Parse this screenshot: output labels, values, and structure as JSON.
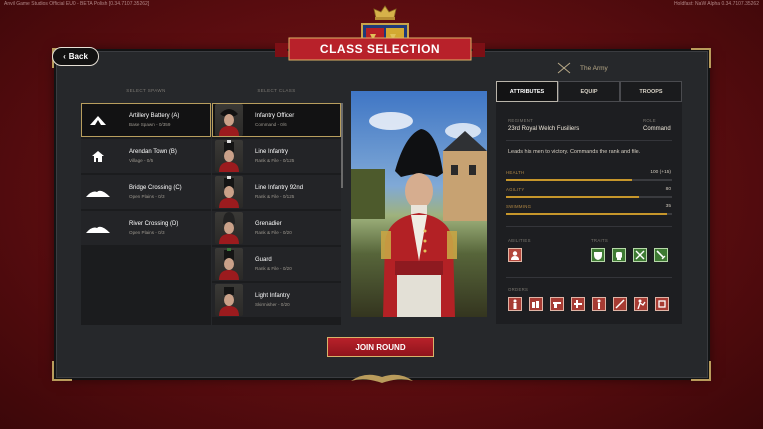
{
  "build_left": "Anvil Game Studios Official EU0 - BETA Polish [0.34.7107.35262]",
  "build_right": "Holdfast: NaW   Alpha   0.34.7107.35262",
  "back_label": "Back",
  "title": "CLASS SELECTION",
  "faction": "The Army",
  "spawn_header": "SELECT SPAWN",
  "class_header": "SELECT CLASS",
  "spawns": [
    {
      "name": "Artillery Battery (A)",
      "sub": "Base Spawn - 0/359",
      "icon": "tent-icon"
    },
    {
      "name": "Arendan Town (B)",
      "sub": "Village - 0/5",
      "icon": "house-icon"
    },
    {
      "name": "Bridge Crossing (C)",
      "sub": "Open Plains - 0/3",
      "icon": "hill-icon"
    },
    {
      "name": "River Crossing (D)",
      "sub": "Open Plains - 0/3",
      "icon": "hill-icon"
    }
  ],
  "classes": [
    {
      "name": "Infantry Officer",
      "sub": "Command - 0/6"
    },
    {
      "name": "Line Infantry",
      "sub": "Rank & File - 0/125"
    },
    {
      "name": "Line Infantry 92nd",
      "sub": "Rank & File - 0/125"
    },
    {
      "name": "Grenadier",
      "sub": "Rank & File - 0/20"
    },
    {
      "name": "Guard",
      "sub": "Rank & File - 0/20"
    },
    {
      "name": "Light Infantry",
      "sub": "Skirmisher - 0/20"
    }
  ],
  "tabs": [
    "ATTRIBUTES",
    "EQUIP",
    "TROOPS"
  ],
  "regiment_label": "REGIMENT",
  "regiment": "23rd Royal Welch Fusiliers",
  "role_label": "ROLE",
  "role": "Command",
  "description": "Leads his men to victory. Commands the rank and file.",
  "stats": [
    {
      "label": "HEALTH",
      "value": "100 (+15)",
      "fraction": 0.76
    },
    {
      "label": "AGILITY",
      "value": "80",
      "fraction": 0.8
    },
    {
      "label": "SWIMMING",
      "value": "35",
      "fraction": 0.97
    }
  ],
  "abilities_label": "ABILITIES",
  "traits_label": "TRAITS",
  "orders_label": "ORDERS",
  "abilities": [
    "officer-portrait-icon"
  ],
  "traits": [
    "shield-trait-icon",
    "fist-trait-icon",
    "crossed-swords-icon",
    "sword-icon"
  ],
  "orders": [
    "soldier-order-icon",
    "form-line-icon",
    "fire-icon",
    "advance-icon",
    "musket-icon",
    "march-icon",
    "charge-icon",
    "halt-icon"
  ],
  "join_label": "JOIN ROUND",
  "colors": {
    "accent_red": "#b8212a",
    "gold": "#c6962b",
    "trait_green": "#3e7a33"
  }
}
